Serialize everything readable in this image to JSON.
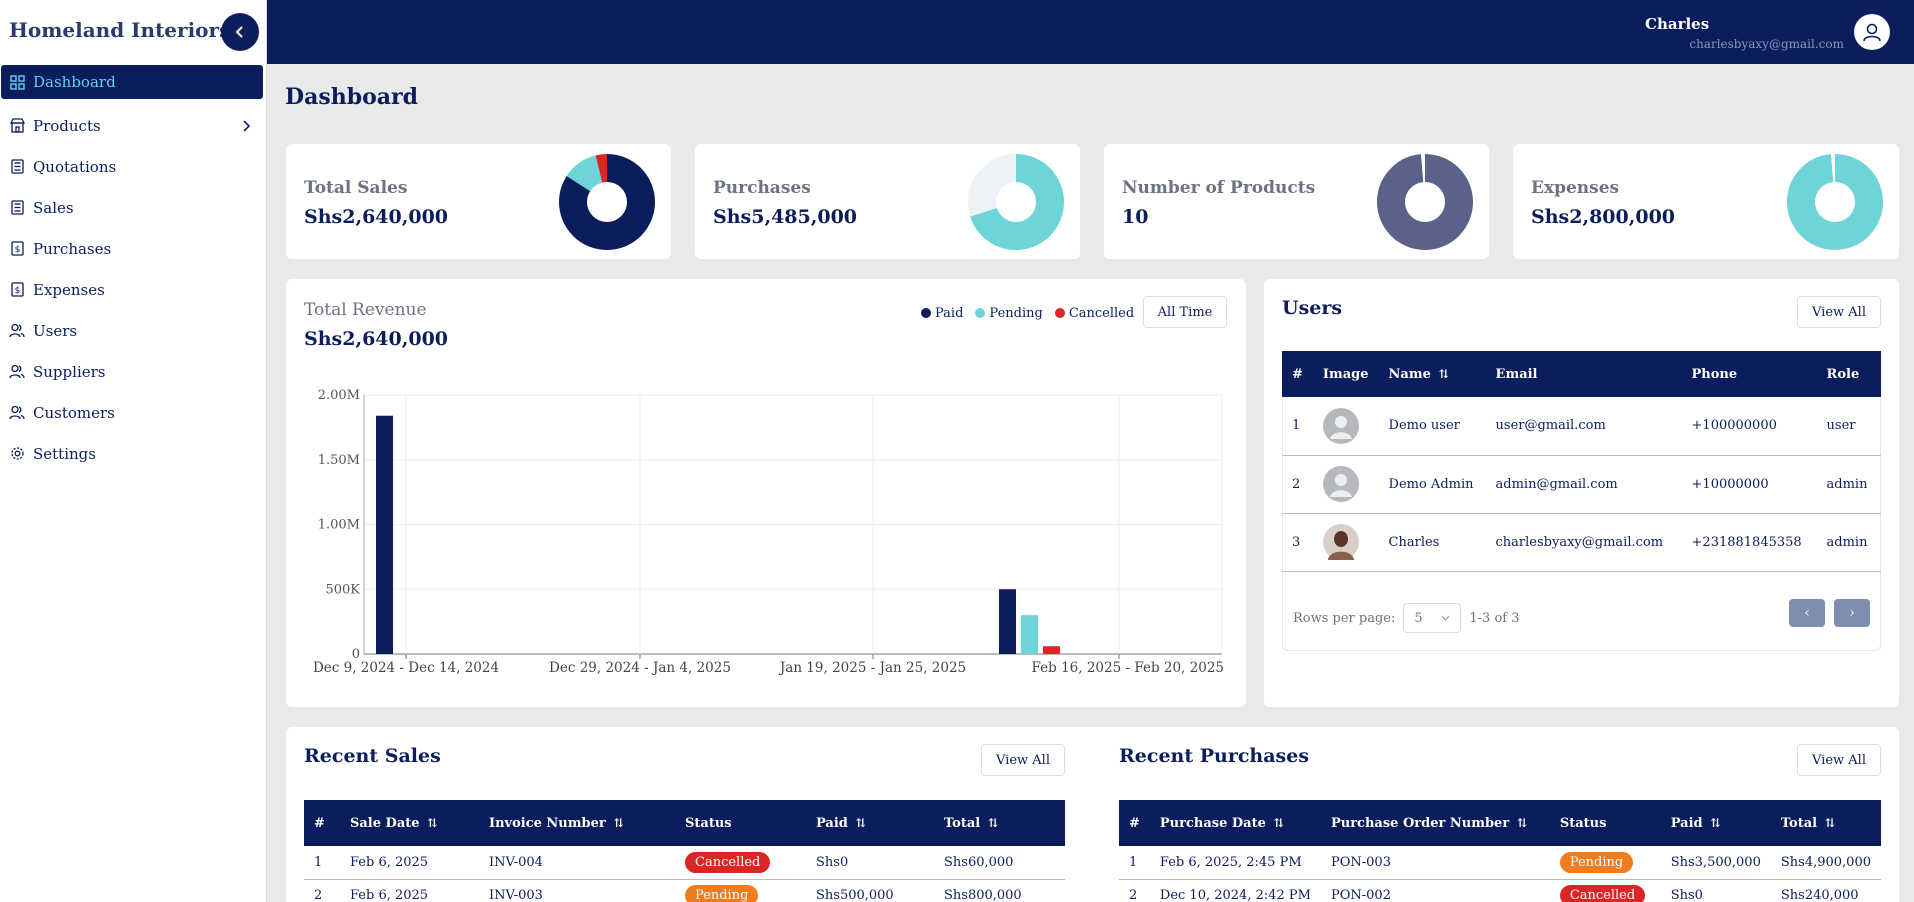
{
  "app": {
    "brand": "Homeland Interiors"
  },
  "sidebar": {
    "items": [
      {
        "label": "Dashboard",
        "icon": "grid-icon",
        "active": true
      },
      {
        "label": "Products",
        "icon": "store-icon",
        "has_submenu": true
      },
      {
        "label": "Quotations",
        "icon": "calculator-icon"
      },
      {
        "label": "Sales",
        "icon": "calculator-icon"
      },
      {
        "label": "Purchases",
        "icon": "dollar-file-icon"
      },
      {
        "label": "Expenses",
        "icon": "dollar-file-icon"
      },
      {
        "label": "Users",
        "icon": "users-icon"
      },
      {
        "label": "Suppliers",
        "icon": "users-icon"
      },
      {
        "label": "Customers",
        "icon": "users-icon"
      },
      {
        "label": "Settings",
        "icon": "gear-icon"
      }
    ]
  },
  "topbar": {
    "user_name": "Charles",
    "user_email": "charlesbyaxy@gmail.com"
  },
  "page": {
    "title": "Dashboard"
  },
  "stats": [
    {
      "label": "Total Sales",
      "value": "Shs2,640,000",
      "donut": [
        {
          "value": 0.84,
          "color": "#0b1d5c"
        },
        {
          "value": 0.12,
          "color": "#6dd5d7"
        },
        {
          "value": 0.04,
          "color": "#dc2626"
        }
      ]
    },
    {
      "label": "Purchases",
      "value": "Shs5,485,000",
      "donut": [
        {
          "value": 0.7,
          "color": "#6dd5d7"
        },
        {
          "value": 0.3,
          "color": "#eef1f6"
        }
      ]
    },
    {
      "label": "Number of Products",
      "value": "10",
      "donut": [
        {
          "value": 0.985,
          "color": "#5b6289"
        },
        {
          "value": 0.015,
          "color": "#ffffff"
        }
      ]
    },
    {
      "label": "Expenses",
      "value": "Shs2,800,000",
      "donut": [
        {
          "value": 0.985,
          "color": "#6dd5d7"
        },
        {
          "value": 0.015,
          "color": "#ffffff"
        }
      ]
    }
  ],
  "revenue": {
    "label": "Total Revenue",
    "value": "Shs2,640,000",
    "legend": [
      {
        "label": "Paid",
        "color": "#0b1d5c"
      },
      {
        "label": "Pending",
        "color": "#6dd5d7"
      },
      {
        "label": "Cancelled",
        "color": "#dc2626"
      }
    ],
    "filter_label": "All Time"
  },
  "chart_data": {
    "type": "bar",
    "categories": [
      "Dec 9, 2024 - Dec 14, 2024",
      "Dec 29, 2024 - Jan 4, 2025",
      "Jan 19, 2025 - Jan 25, 2025",
      "Feb 16, 2025 - Feb 20, 2025"
    ],
    "series": [
      {
        "name": "Paid",
        "color": "#0b1d5c",
        "values": [
          1840000,
          0,
          0,
          500000
        ]
      },
      {
        "name": "Pending",
        "color": "#6dd5d7",
        "values": [
          0,
          0,
          0,
          300000
        ]
      },
      {
        "name": "Cancelled",
        "color": "#dc2626",
        "values": [
          0,
          0,
          0,
          60000
        ]
      }
    ],
    "ylim": [
      0,
      2000000
    ],
    "yticks": [
      "0",
      "500K",
      "1.00M",
      "1.50M",
      "2.00M"
    ],
    "grid": true
  },
  "users": {
    "title": "Users",
    "view_all": "View All",
    "columns": [
      "#",
      "Image",
      "Name",
      "Email",
      "Phone",
      "Role"
    ],
    "rows": [
      {
        "n": "1",
        "name": "Demo user",
        "email": "user@gmail.com",
        "phone": "+100000000",
        "role": "user",
        "avatar": "placeholder"
      },
      {
        "n": "2",
        "name": "Demo Admin",
        "email": "admin@gmail.com",
        "phone": "+10000000",
        "role": "admin",
        "avatar": "placeholder"
      },
      {
        "n": "3",
        "name": "Charles",
        "email": "charlesbyaxy@gmail.com",
        "phone": "+231881845358",
        "role": "admin",
        "avatar": "photo"
      }
    ],
    "rows_per_page_label": "Rows per page:",
    "rows_per_page": "5",
    "range": "1-3 of 3"
  },
  "recent_sales": {
    "title": "Recent Sales",
    "view_all": "View All",
    "columns": [
      "#",
      "Sale Date",
      "Invoice Number",
      "Status",
      "Paid",
      "Total"
    ],
    "rows": [
      {
        "n": "1",
        "date": "Feb 6, 2025",
        "invoice": "INV-004",
        "status": "Cancelled",
        "paid": "Shs0",
        "total": "Shs60,000"
      },
      {
        "n": "2",
        "date": "Feb 6, 2025",
        "invoice": "INV-003",
        "status": "Pending",
        "paid": "Shs500,000",
        "total": "Shs800,000"
      }
    ]
  },
  "recent_purchases": {
    "title": "Recent Purchases",
    "view_all": "View All",
    "columns": [
      "#",
      "Purchase Date",
      "Purchase Order Number",
      "Status",
      "Paid",
      "Total"
    ],
    "rows": [
      {
        "n": "1",
        "date": "Feb 6, 2025, 2:45 PM",
        "order": "PON-003",
        "status": "Pending",
        "paid": "Shs3,500,000",
        "total": "Shs4,900,000"
      },
      {
        "n": "2",
        "date": "Dec 10, 2024, 2:42 PM",
        "order": "PON-002",
        "status": "Cancelled",
        "paid": "Shs0",
        "total": "Shs240,000"
      }
    ]
  }
}
